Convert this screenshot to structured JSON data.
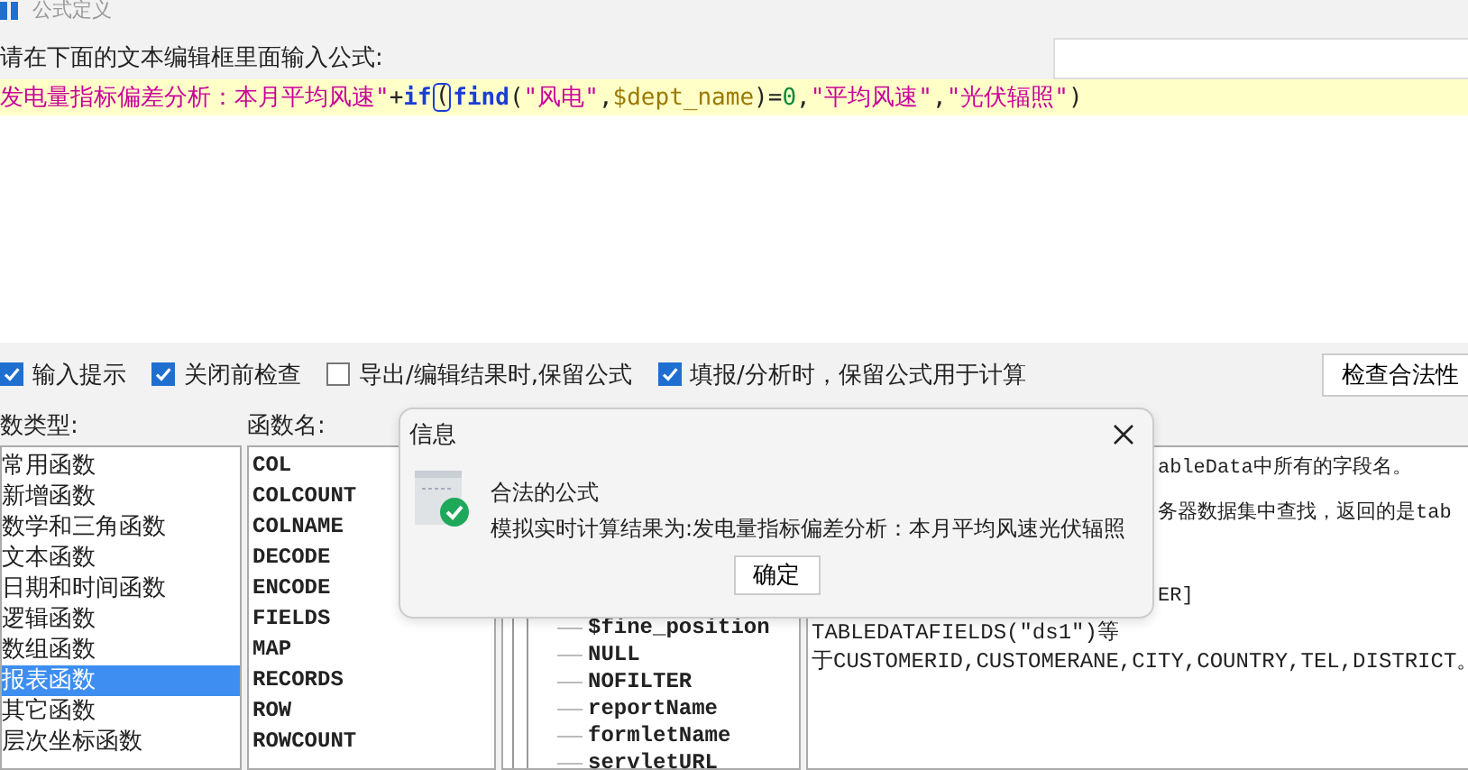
{
  "window": {
    "title": "公式定义"
  },
  "prompt": "请在下面的文本编辑框里面输入公式:",
  "formula": [
    {
      "kind": "string",
      "text": "发电量指标偏差分析：本月平均风速\""
    },
    {
      "kind": "op",
      "text": "+"
    },
    {
      "kind": "keyword",
      "text": "if"
    },
    {
      "kind": "cursor",
      "text": "("
    },
    {
      "kind": "keyword",
      "text": "find"
    },
    {
      "kind": "op",
      "text": "("
    },
    {
      "kind": "string",
      "text": "\"风电\""
    },
    {
      "kind": "op",
      "text": ","
    },
    {
      "kind": "variable",
      "text": "$dept_name"
    },
    {
      "kind": "op",
      "text": ")="
    },
    {
      "kind": "number",
      "text": "0"
    },
    {
      "kind": "op",
      "text": ","
    },
    {
      "kind": "string",
      "text": "\"平均风速\""
    },
    {
      "kind": "op",
      "text": ","
    },
    {
      "kind": "string",
      "text": "\"光伏辐照\""
    },
    {
      "kind": "op",
      "text": ")"
    }
  ],
  "options": [
    {
      "label": "输入提示",
      "checked": true
    },
    {
      "label": "关闭前检查",
      "checked": true
    },
    {
      "label": "导出/编辑结果时,保留公式",
      "checked": false
    },
    {
      "label": "填报/分析时，保留公式用于计算",
      "checked": true
    }
  ],
  "buttons": [
    "检查合法性"
  ],
  "type_heading": "数类型:",
  "name_heading": "函数名:",
  "types": [
    {
      "label": "常用函数",
      "selected": false
    },
    {
      "label": "新增函数",
      "selected": false
    },
    {
      "label": "数学和三角函数",
      "selected": false
    },
    {
      "label": "文本函数",
      "selected": false
    },
    {
      "label": "日期和时间函数",
      "selected": false
    },
    {
      "label": "逻辑函数",
      "selected": false
    },
    {
      "label": "数组函数",
      "selected": false
    },
    {
      "label": "报表函数",
      "selected": true
    },
    {
      "label": "其它函数",
      "selected": false
    },
    {
      "label": "层次坐标函数",
      "selected": false
    }
  ],
  "functions": [
    "COL",
    "COLCOUNT",
    "COLNAME",
    "DECODE",
    "ENCODE",
    "FIELDS",
    "MAP",
    "RECORDS",
    "ROW",
    "ROWCOUNT"
  ],
  "variables": [
    "$fine_position",
    "NULL",
    "NOFILTER",
    "reportName",
    "formletName",
    "servletURL"
  ],
  "description": [
    {
      "kind": "covered",
      "text": "ableData中所有的字段名。"
    },
    {
      "kind": "covered",
      "text": "务器数据集中查找，返回的是tab"
    },
    {
      "kind": "covered",
      "text": "ER]"
    },
    {
      "kind": "full",
      "text": "TABLEDATAFIELDS(\"ds1\")等"
    },
    {
      "kind": "full",
      "text": "于CUSTOMERID,CUSTOMERANE,CITY,COUNTRY,TEL,DISTRICT。"
    }
  ],
  "dialog": {
    "title": "信息",
    "heading": "合法的公式",
    "message": "模拟实时计算结果为:发电量指标偏差分析：本月平均风速光伏辐照",
    "button": "确定"
  }
}
